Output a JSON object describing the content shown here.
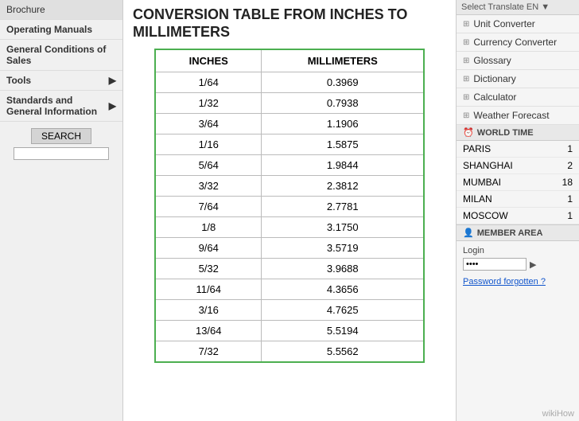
{
  "sidebar": {
    "items": [
      {
        "label": "Brochure",
        "bold": false,
        "arrow": false
      },
      {
        "label": "Operating Manuals",
        "bold": true,
        "arrow": false
      },
      {
        "label": "General Conditions of Sales",
        "bold": true,
        "arrow": false
      },
      {
        "label": "Tools",
        "bold": true,
        "arrow": true
      },
      {
        "label": "Standards and General Information",
        "bold": true,
        "arrow": true
      }
    ],
    "search_label": "SEARCH",
    "search_placeholder": ""
  },
  "header": {
    "title_line1": "CONVERSION TABLE FROM INCHES TO",
    "title_line2": "MILLIMETERS"
  },
  "table": {
    "col1_header": "INCHES",
    "col2_header": "MILLIMETERS",
    "rows": [
      {
        "inches": "1/64",
        "mm": "0.3969"
      },
      {
        "inches": "1/32",
        "mm": "0.7938"
      },
      {
        "inches": "3/64",
        "mm": "1.1906"
      },
      {
        "inches": "1/16",
        "mm": "1.5875"
      },
      {
        "inches": "5/64",
        "mm": "1.9844"
      },
      {
        "inches": "3/32",
        "mm": "2.3812"
      },
      {
        "inches": "7/64",
        "mm": "2.7781"
      },
      {
        "inches": "1/8",
        "mm": "3.1750"
      },
      {
        "inches": "9/64",
        "mm": "3.5719"
      },
      {
        "inches": "5/32",
        "mm": "3.9688"
      },
      {
        "inches": "11/64",
        "mm": "4.3656"
      },
      {
        "inches": "3/16",
        "mm": "4.7625"
      },
      {
        "inches": "13/64",
        "mm": "5.5194"
      },
      {
        "inches": "7/32",
        "mm": "5.5562"
      }
    ]
  },
  "right_panel": {
    "top_text": "Select Translate EN ▼",
    "links": [
      {
        "label": "Unit Converter"
      },
      {
        "label": "Currency Converter"
      },
      {
        "label": "Glossary"
      },
      {
        "label": "Dictionary"
      },
      {
        "label": "Calculator"
      },
      {
        "label": "Weather Forecast"
      }
    ],
    "world_time_header": "WORLD TIME",
    "world_time_rows": [
      {
        "city": "PARIS",
        "time": "1"
      },
      {
        "city": "SHANGHAI",
        "time": "2"
      },
      {
        "city": "MUMBAI",
        "time": "18"
      },
      {
        "city": "MILAN",
        "time": "1"
      },
      {
        "city": "MOSCOW",
        "time": "1"
      }
    ],
    "member_area_header": "MEMBER AREA",
    "login_label": "Login",
    "password_input_value": "••••",
    "password_forgotten": "Password forgotten ?"
  },
  "footer": {
    "badge": "wikiHow"
  }
}
